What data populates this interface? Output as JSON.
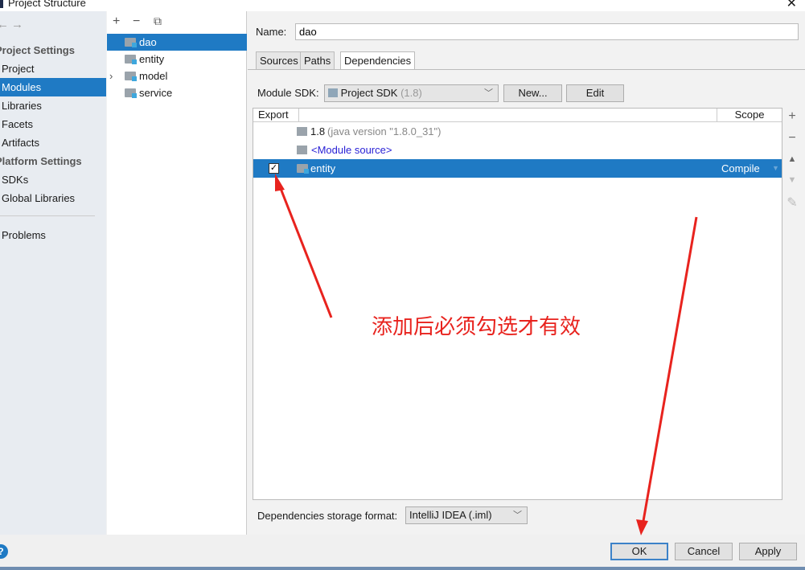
{
  "window": {
    "title": "Project Structure",
    "close": "✕"
  },
  "sidebar": {
    "back": "←",
    "forward": "→",
    "sections": [
      {
        "label": "Project Settings"
      },
      {
        "label": "Platform Settings"
      }
    ],
    "items": [
      {
        "label": "Project"
      },
      {
        "label": "Modules",
        "selected": true
      },
      {
        "label": "Libraries"
      },
      {
        "label": "Facets"
      },
      {
        "label": "Artifacts"
      },
      {
        "label": "SDKs"
      },
      {
        "label": "Global Libraries"
      },
      {
        "label": "Problems"
      }
    ]
  },
  "tree": {
    "add": "+",
    "remove": "−",
    "copy": "⧉",
    "modules": [
      {
        "label": "dao",
        "selected": true
      },
      {
        "label": "entity"
      },
      {
        "label": "model",
        "expandable": true
      },
      {
        "label": "service"
      }
    ]
  },
  "main": {
    "name_label": "Name:",
    "name_value": "dao",
    "tabs": [
      {
        "label": "Sources"
      },
      {
        "label": "Paths"
      },
      {
        "label": "Dependencies",
        "active": true
      }
    ],
    "sdk_label": "Module SDK:",
    "sdk_value": "Project SDK",
    "sdk_version": "(1.8)",
    "new_button": "New...",
    "edit_button": "Edit",
    "table": {
      "headers": [
        "Export",
        "Scope"
      ],
      "rows": [
        {
          "name": "1.8",
          "detail": "(java version \"1.8.0_31\")",
          "scope": ""
        },
        {
          "name": "<Module source>",
          "detail": "",
          "scope": ""
        },
        {
          "name": "entity",
          "detail": "",
          "scope": "Compile",
          "checked": true,
          "selected": true
        }
      ]
    },
    "side_buttons": [
      "+",
      "−",
      "▲",
      "▼",
      "✎"
    ],
    "storage_label": "Dependencies storage format:",
    "storage_value": "IntelliJ IDEA (.iml)"
  },
  "footer": {
    "help": "?",
    "ok": "OK",
    "cancel": "Cancel",
    "apply": "Apply"
  },
  "annotation": {
    "text": "添加后必须勾选才有效",
    "color": "#e8231e"
  },
  "colors": {
    "selection": "#1f7ac4",
    "link": "#2a22d6"
  }
}
